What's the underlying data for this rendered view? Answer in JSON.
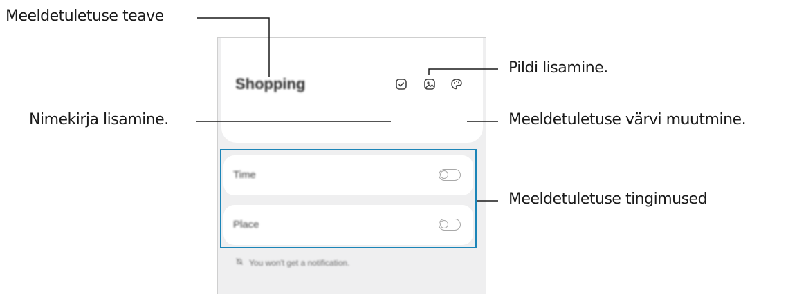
{
  "note": {
    "title": "Shopping",
    "icons": [
      "checklist-icon",
      "image-icon",
      "palette-icon"
    ]
  },
  "conditions": [
    {
      "label": "Time",
      "enabled": false
    },
    {
      "label": "Place",
      "enabled": false
    }
  ],
  "notice": "You won't get a notification.",
  "callouts": {
    "info": "Meeldetuletuse teave",
    "checklist": "Nimekirja lisamine.",
    "image": "Pildi lisamine.",
    "color": "Meeldetuletuse värvi muutmine.",
    "conditions": "Meeldetuletuse tingimused"
  },
  "colors": {
    "accent": "#1c85b8",
    "phone_bg": "#efeff0"
  }
}
